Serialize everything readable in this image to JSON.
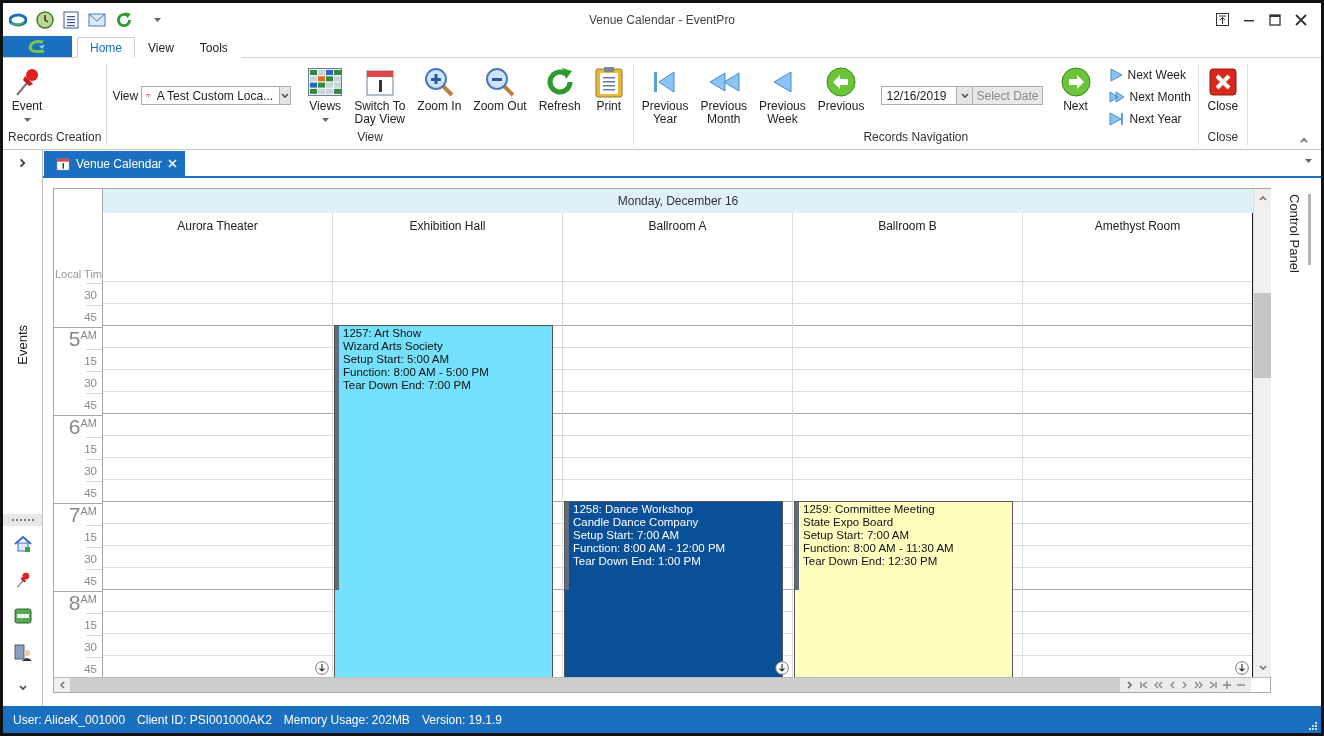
{
  "window": {
    "title": "Venue Calendar - EventPro"
  },
  "ribbon_tabs": [
    {
      "label": "Home",
      "selected": true
    },
    {
      "label": "View",
      "selected": false
    },
    {
      "label": "Tools",
      "selected": false
    }
  ],
  "ribbon_groups": [
    {
      "label": "Records Creation",
      "items": [
        {
          "kind": "large",
          "lines": [
            "Event"
          ],
          "has_menu": true
        }
      ]
    },
    {
      "label": "View",
      "items": [
        {
          "kind": "select",
          "label": "View",
          "value": "A Test Custom Loca..."
        },
        {
          "kind": "large",
          "lines": [
            "Views"
          ],
          "has_menu": true
        },
        {
          "kind": "large",
          "lines": [
            "Switch To",
            "Day View"
          ],
          "has_menu": false
        },
        {
          "kind": "large",
          "lines": [
            "Zoom In"
          ],
          "has_menu": false
        },
        {
          "kind": "large",
          "lines": [
            "Zoom Out"
          ],
          "has_menu": false
        },
        {
          "kind": "large",
          "lines": [
            "Refresh"
          ],
          "has_menu": false
        },
        {
          "kind": "large",
          "lines": [
            "Print"
          ],
          "has_menu": false
        }
      ]
    },
    {
      "label": "Records Navigation",
      "items": [
        {
          "kind": "large",
          "lines": [
            "Previous",
            "Year"
          ],
          "has_menu": false
        },
        {
          "kind": "large",
          "lines": [
            "Previous",
            "Month"
          ],
          "has_menu": false
        },
        {
          "kind": "large",
          "lines": [
            "Previous",
            "Week"
          ],
          "has_menu": false
        },
        {
          "kind": "large",
          "lines": [
            "Previous"
          ],
          "has_menu": false
        },
        {
          "kind": "date",
          "value": "12/16/2019",
          "button": "Select Date",
          "disabled": true
        },
        {
          "kind": "large",
          "lines": [
            "Next"
          ],
          "has_menu": false
        },
        {
          "kind": "stack",
          "entries": [
            "Next Week",
            "Next Month",
            "Next Year"
          ]
        }
      ]
    },
    {
      "label": "Close",
      "items": [
        {
          "kind": "large",
          "lines": [
            "Close"
          ],
          "has_menu": false
        }
      ]
    }
  ],
  "document_tab": {
    "label": "Venue Calendar"
  },
  "left_panel": {
    "label": "Events"
  },
  "right_panel": {
    "label": "Control Panel"
  },
  "calendar": {
    "date_header": "Monday, December 16",
    "time_label": "Local Tim",
    "time_slots": [
      {
        "kind": "quarter",
        "label": "30"
      },
      {
        "kind": "quarter",
        "label": "45"
      },
      {
        "kind": "hour",
        "hour": "5",
        "suffix": "AM"
      },
      {
        "kind": "quarter",
        "label": "15"
      },
      {
        "kind": "quarter",
        "label": "30"
      },
      {
        "kind": "quarter",
        "label": "45"
      },
      {
        "kind": "hour",
        "hour": "6",
        "suffix": "AM"
      },
      {
        "kind": "quarter",
        "label": "15"
      },
      {
        "kind": "quarter",
        "label": "30"
      },
      {
        "kind": "quarter",
        "label": "45"
      },
      {
        "kind": "hour",
        "hour": "7",
        "suffix": "AM"
      },
      {
        "kind": "quarter",
        "label": "15"
      },
      {
        "kind": "quarter",
        "label": "30"
      },
      {
        "kind": "quarter",
        "label": "45"
      },
      {
        "kind": "hour",
        "hour": "8",
        "suffix": "AM"
      },
      {
        "kind": "quarter",
        "label": "15"
      },
      {
        "kind": "quarter",
        "label": "30"
      },
      {
        "kind": "quarter",
        "label": "45"
      }
    ],
    "resources": [
      {
        "name": "Aurora Theater",
        "more_below": true
      },
      {
        "name": "Exhibition Hall",
        "more_below": false,
        "events": [
          {
            "title": "1257: Art Show",
            "organization": "Wizard Arts Society",
            "setup": "Setup Start: 5:00 AM",
            "function": "Function: 8:00 AM - 5:00 PM",
            "teardown": "Tear Down End: 7:00 PM",
            "color": "#74e0fc"
          }
        ]
      },
      {
        "name": "Ballroom A",
        "more_below": true,
        "events": [
          {
            "title": "1258: Dance Workshop",
            "organization": "Candle Dance Company",
            "setup": "Setup Start: 7:00 AM",
            "function": "Function: 8:00 AM - 12:00 PM",
            "teardown": "Tear Down End: 1:00 PM",
            "color": "#0a5099"
          }
        ]
      },
      {
        "name": "Ballroom B",
        "more_below": false,
        "events": [
          {
            "title": "1259: Committee Meeting",
            "organization": "State Expo Board",
            "setup": "Setup Start: 7:00 AM",
            "function": "Function: 8:00 AM - 11:30 AM",
            "teardown": "Tear Down End: 12:30 PM",
            "color": "#ffffc0"
          }
        ]
      },
      {
        "name": "Amethyst Room",
        "more_below": true
      }
    ]
  },
  "status_bar": [
    "User: AliceK_001000",
    "Client ID: PSI001000AK2",
    "Memory Usage: 202MB",
    "Version: 19.1.9"
  ]
}
